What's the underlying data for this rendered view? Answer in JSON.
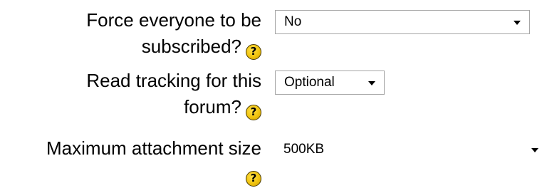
{
  "fields": [
    {
      "label_lines": [
        "Force everyone to be",
        "subscribed?"
      ],
      "value": "No",
      "help_icon": "help-icon"
    },
    {
      "label_lines": [
        "Read tracking for this",
        "forum?"
      ],
      "value": "Optional",
      "help_icon": "help-icon"
    },
    {
      "label_lines": [
        "Maximum attachment size"
      ],
      "value": "500KB",
      "help_icon": "help-icon"
    }
  ],
  "help_glyph": "?",
  "colors": {
    "help_icon_fill": "#f1c40f",
    "select_border": "#a6a6a6"
  }
}
